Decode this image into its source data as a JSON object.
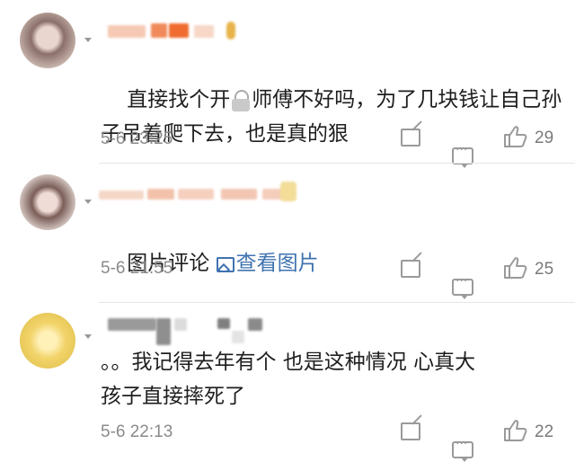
{
  "comments": [
    {
      "text_before_icon": "直接找个开",
      "text_after_icon": "师傅不好吗，为了几块钱让自己孙子吊着爬下去，也是真的狠",
      "time": "5-6 23:25",
      "likes": "29"
    },
    {
      "text_prefix": "图片评论 ",
      "link_text": "查看图片",
      "time": "5-6 21:55",
      "likes": "25"
    },
    {
      "text": "。。我记得去年有个 也是这种情况 心真大\n孩子直接摔死了",
      "time": "5-6 22:13",
      "likes": "22"
    }
  ],
  "icons": {
    "share": "share-icon",
    "comment": "comment-icon",
    "like": "thumbs-up-icon",
    "lock": "lock-icon",
    "picture": "picture-icon"
  },
  "colors": {
    "link": "#3f73b0",
    "meta": "#8a8a8a",
    "icon": "#9a9a9a"
  }
}
